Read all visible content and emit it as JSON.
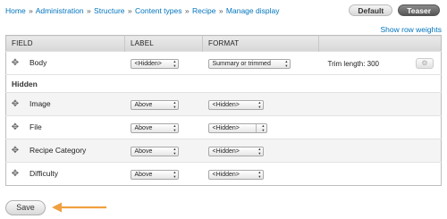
{
  "breadcrumb": [
    "Home",
    "Administration",
    "Structure",
    "Content types",
    "Recipe",
    "Manage display"
  ],
  "breadcrumb_sep": "»",
  "view_modes": [
    "Default",
    "Teaser"
  ],
  "active_view_mode": "Teaser",
  "row_weights_link": "Show row weights",
  "table": {
    "headers": [
      "FIELD",
      "LABEL",
      "FORMAT"
    ],
    "visible_rows": [
      {
        "field": "Body",
        "label": "<Hidden>",
        "format": "Summary or trimmed",
        "summary": "Trim length: 300"
      }
    ],
    "hidden_region": "Hidden",
    "hidden_rows": [
      {
        "field": "Image",
        "label": "Above",
        "format": "<Hidden>"
      },
      {
        "field": "File",
        "label": "Above",
        "format": "<Hidden>"
      },
      {
        "field": "Recipe Category",
        "label": "Above",
        "format": "<Hidden>"
      },
      {
        "field": "Difficulty",
        "label": "Above",
        "format": "<Hidden>"
      }
    ]
  },
  "save_label": "Save",
  "icons": {
    "drag": "drag-handle-icon",
    "settings": "gear-icon",
    "arrow": "arrow-left-icon"
  },
  "colors": {
    "link": "#0074bd",
    "arrow": "#f0a040",
    "active_tab": "#555555"
  }
}
